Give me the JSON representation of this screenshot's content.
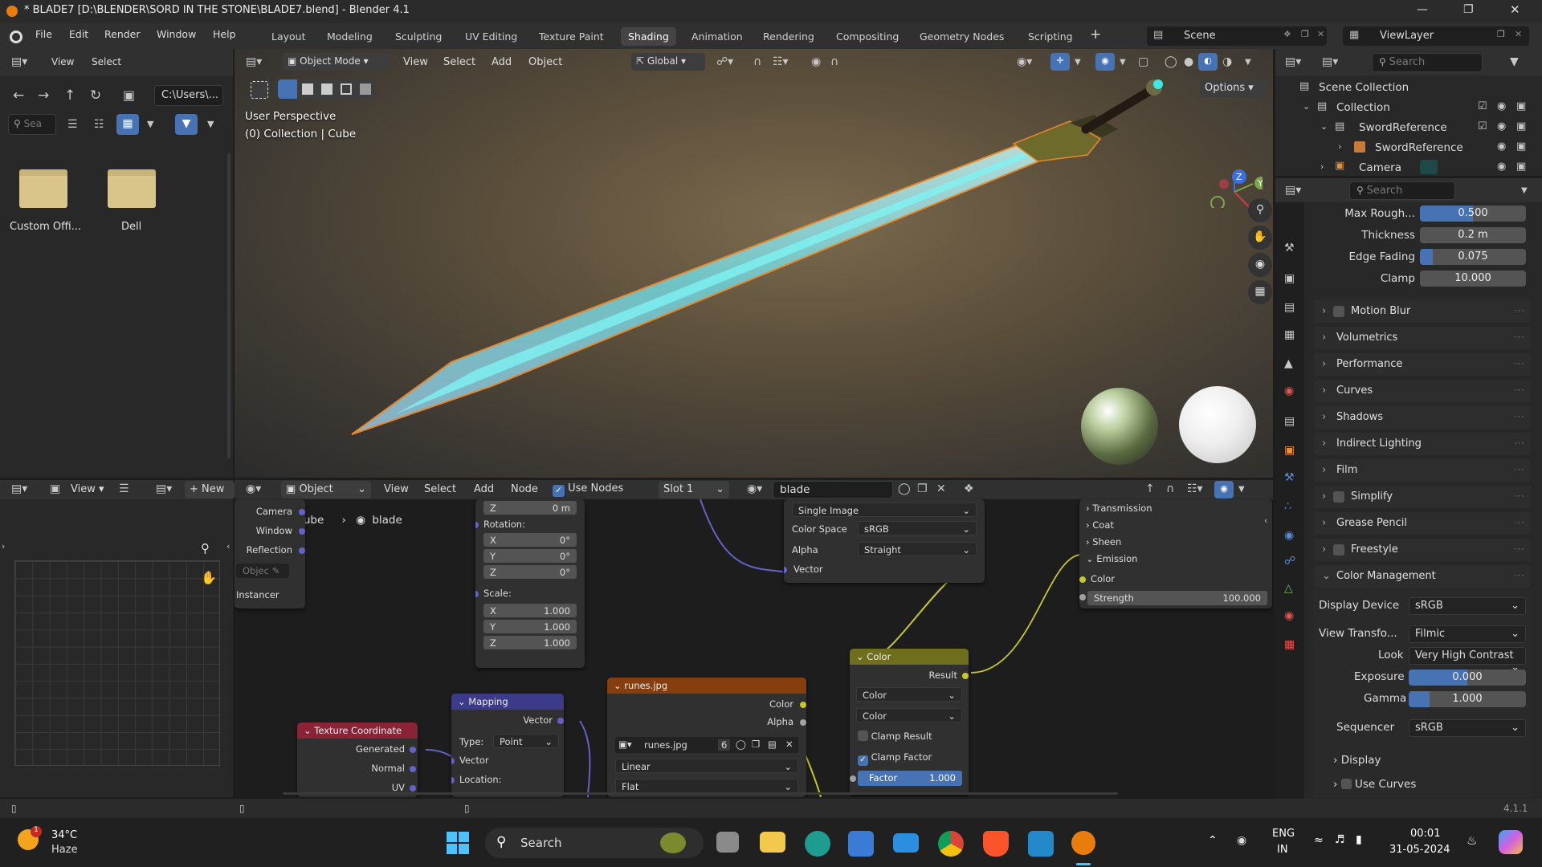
{
  "window": {
    "title": "* BLADE7 [D:\\BLENDER\\SORD IN THE STONE\\BLADE7.blend] - Blender 4.1"
  },
  "menu": {
    "file": "File",
    "edit": "Edit",
    "render": "Render",
    "window": "Window",
    "help": "Help"
  },
  "workspaces": [
    "Layout",
    "Modeling",
    "Sculpting",
    "UV Editing",
    "Texture Paint",
    "Shading",
    "Animation",
    "Rendering",
    "Compositing",
    "Geometry Nodes",
    "Scripting"
  ],
  "active_workspace": "Shading",
  "scene": "Scene",
  "view_layer": "ViewLayer",
  "filebrowser": {
    "view": "View",
    "select": "Select",
    "path": "C:\\Users\\...",
    "search_placeholder": "Sea",
    "items": [
      "Custom Offi...",
      "Dell"
    ]
  },
  "viewport": {
    "mode": "Object Mode",
    "view": "View",
    "select": "Select",
    "add": "Add",
    "object": "Object",
    "transform": "Global",
    "options": "Options",
    "info_line1": "User Perspective",
    "info_line2": "(0) Collection | Cube"
  },
  "outliner": {
    "search_placeholder": "Search",
    "rows": [
      "Scene Collection",
      "Collection",
      "SwordReference",
      "SwordReference",
      "Camera"
    ]
  },
  "props": {
    "search_placeholder": "Search",
    "fields": [
      {
        "label": "Max Rough...",
        "value": "0.500",
        "fill": 0.5
      },
      {
        "label": "Thickness",
        "value": "0.2 m",
        "fill": 0
      },
      {
        "label": "Edge Fading",
        "value": "0.075",
        "fill": 0.075
      },
      {
        "label": "Clamp",
        "value": "10.000",
        "fill": 0
      }
    ],
    "sections": [
      "Motion Blur",
      "Volumetrics",
      "Performance",
      "Curves",
      "Shadows",
      "Indirect Lighting",
      "Film",
      "Simplify",
      "Grease Pencil",
      "Freestyle",
      "Color Management"
    ],
    "cm": {
      "display_device_label": "Display Device",
      "display_device": "sRGB",
      "view_transform_label": "View Transfo...",
      "view_transform": "Filmic",
      "look_label": "Look",
      "look": "Very High Contrast",
      "exposure_label": "Exposure",
      "exposure": "0.000",
      "gamma_label": "Gamma",
      "gamma": "1.000",
      "sequencer_label": "Sequencer",
      "sequencer": "sRGB",
      "display": "Display",
      "use_curves": "Use Curves"
    }
  },
  "image_editor": {
    "view": "View",
    "new": "New"
  },
  "node_editor": {
    "type": "Object",
    "view": "View",
    "select": "Select",
    "add": "Add",
    "node": "Node",
    "use_nodes": "Use Nodes",
    "slot": "Slot 1",
    "material": "blade",
    "breadcrumb_obj": "Cube",
    "breadcrumb_mat": "blade"
  },
  "nodes": {
    "partial_left": {
      "camera": "Camera",
      "window": "Window",
      "reflection": "Reflection",
      "object": "Objec",
      "instancer": "Instancer"
    },
    "transform_part": {
      "z_loc": "0 m",
      "rotation": "Rotation:",
      "rx": "0°",
      "ry": "0°",
      "rz": "0°",
      "scale": "Scale:",
      "sx": "1.000",
      "sy": "1.000",
      "sz": "1.000"
    },
    "image_part": {
      "projection": "Single Image",
      "color_space_label": "Color Space",
      "color_space": "sRGB",
      "alpha_label": "Alpha",
      "alpha": "Straight",
      "vector": "Vector"
    },
    "shader_part": {
      "transmission": "Transmission",
      "coat": "Coat",
      "sheen": "Sheen",
      "emission": "Emission",
      "color": "Color",
      "strength_label": "Strength",
      "strength": "100.000"
    },
    "mix_color": {
      "title": "Color",
      "result": "Result",
      "a": "Color",
      "b": "Color",
      "clamp_result": "Clamp Result",
      "clamp_factor": "Clamp Factor",
      "factor_label": "Factor",
      "factor": "1.000"
    },
    "runes": {
      "title": "runes.jpg",
      "color": "Color",
      "alpha": "Alpha",
      "image": "runes.jpg",
      "users": "6",
      "interp": "Linear",
      "proj": "Flat"
    },
    "mapping": {
      "title": "Mapping",
      "vector_out": "Vector",
      "type_label": "Type:",
      "type": "Point",
      "vector_in": "Vector",
      "location": "Location:"
    },
    "texcoord": {
      "title": "Texture Coordinate",
      "generated": "Generated",
      "normal": "Normal",
      "uv": "UV"
    }
  },
  "status": {
    "version": "4.1.1"
  },
  "taskbar": {
    "weather_temp": "34°C",
    "weather_desc": "Haze",
    "badge": "1",
    "search": "Search",
    "lang1": "ENG",
    "lang2": "IN",
    "time": "00:01",
    "date": "31-05-2024"
  },
  "colors": {
    "accent": "#4772b3",
    "active_orange": "#e58f2a",
    "node_texcoord": "#8b2337",
    "node_mapping": "#3b3b8a",
    "node_image": "#873e0e",
    "node_color": "#6e6e1d"
  }
}
